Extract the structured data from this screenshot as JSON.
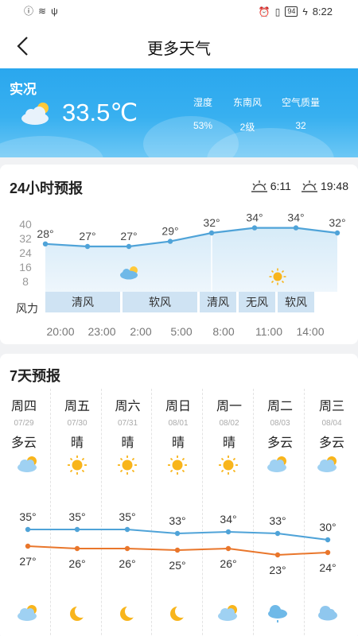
{
  "status_bar": {
    "time": "8:22",
    "battery": "94"
  },
  "header": {
    "title": "更多天气"
  },
  "current": {
    "label": "实况",
    "temperature": "33.5℃",
    "condition_icon": "cloudy-sun-icon",
    "metrics": [
      {
        "label": "湿度",
        "value": "53%"
      },
      {
        "label": "东南风",
        "value": "2级"
      },
      {
        "label": "空气质量",
        "value": "32"
      }
    ]
  },
  "hourly": {
    "title": "24小时预报",
    "sunrise": "6:11",
    "sunset": "19:48",
    "y_ticks": [
      "40",
      "32",
      "24",
      "16",
      "8"
    ],
    "wind_label": "风力",
    "temps": [
      "28°",
      "27°",
      "27°",
      "29°",
      "32°",
      "34°",
      "34°",
      "32°"
    ],
    "temp_values": [
      28,
      27,
      27,
      29,
      32,
      34,
      34,
      32
    ],
    "times": [
      "20:00",
      "23:00",
      "2:00",
      "5:00",
      "8:00",
      "11:00",
      "14:00"
    ],
    "wind": [
      "清风",
      "软风",
      "清风",
      "无风",
      "软风"
    ],
    "icons": [
      "cloudy-moon-icon",
      "sun-icon"
    ]
  },
  "daily": {
    "title": "7天预报",
    "days": [
      {
        "name": "周四",
        "date": "07/29",
        "cond": "多云",
        "icon": "cloudy-sun-icon",
        "high": "35°",
        "low": "27°",
        "night_icon": "cloudy-moon-icon"
      },
      {
        "name": "周五",
        "date": "07/30",
        "cond": "晴",
        "icon": "sun-icon",
        "high": "35°",
        "low": "26°",
        "night_icon": "moon-icon"
      },
      {
        "name": "周六",
        "date": "07/31",
        "cond": "晴",
        "icon": "sun-icon",
        "high": "35°",
        "low": "26°",
        "night_icon": "moon-icon"
      },
      {
        "name": "周日",
        "date": "08/01",
        "cond": "晴",
        "icon": "sun-icon",
        "high": "33°",
        "low": "25°",
        "night_icon": "moon-icon"
      },
      {
        "name": "周一",
        "date": "08/02",
        "cond": "晴",
        "icon": "sun-icon",
        "high": "34°",
        "low": "26°",
        "night_icon": "cloudy-moon-icon"
      },
      {
        "name": "周二",
        "date": "08/03",
        "cond": "多云",
        "icon": "cloudy-sun-icon",
        "high": "33°",
        "low": "23°",
        "night_icon": "rain-cloud-icon"
      },
      {
        "name": "周三",
        "date": "08/04",
        "cond": "多云",
        "icon": "cloudy-sun-icon",
        "high": "30°",
        "low": "24°",
        "night_icon": "cloud-icon"
      }
    ],
    "highs": [
      35,
      35,
      35,
      33,
      34,
      33,
      30
    ],
    "lows": [
      27,
      26,
      26,
      25,
      26,
      23,
      24
    ]
  },
  "colors": {
    "high_line": "#4fa3d8",
    "low_line": "#e9762b",
    "hero_top": "#2aa7ee"
  }
}
